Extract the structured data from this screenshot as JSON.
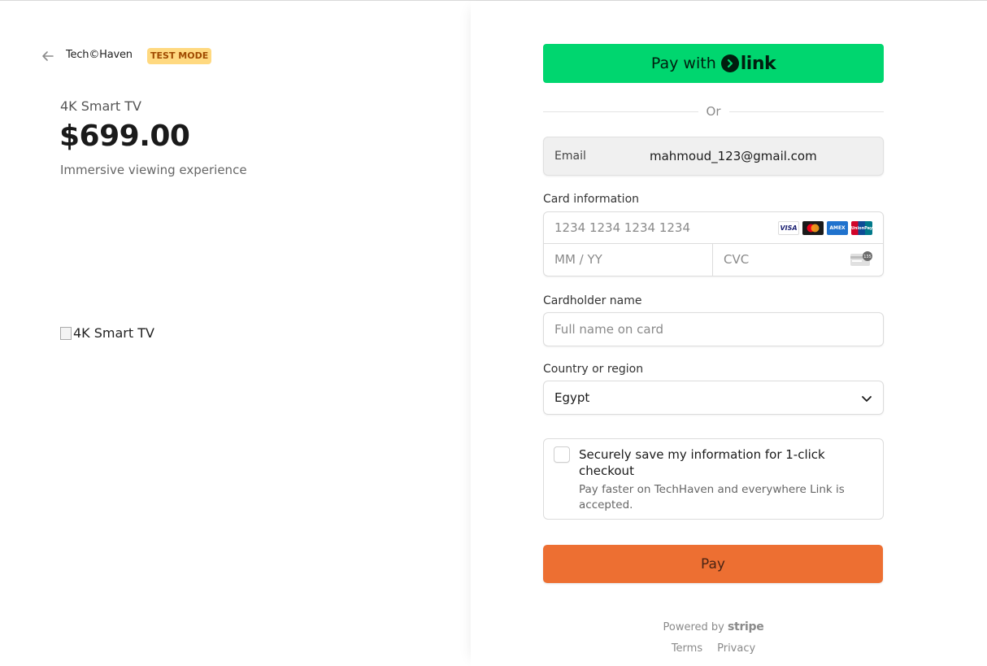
{
  "merchant": {
    "brand": "Tech©Haven",
    "test_badge": "TEST MODE"
  },
  "product": {
    "name": "4K Smart TV",
    "price": "$699.00",
    "description": "Immersive viewing experience",
    "image_alt": "4K Smart TV"
  },
  "link_button": {
    "prefix": "Pay with",
    "brand": "link"
  },
  "divider_text": "Or",
  "email": {
    "label": "Email",
    "value": "mahmoud_123@gmail.com"
  },
  "card": {
    "label": "Card information",
    "number_placeholder": "1234 1234 1234 1234",
    "expiry_placeholder": "MM / YY",
    "cvc_placeholder": "CVC",
    "brand_icons": [
      "visa-icon",
      "mastercard-icon",
      "amex-icon",
      "unionpay-icon"
    ],
    "visa_text": "VISA",
    "amex_text": "AMEX",
    "unionpay_text": "UnionPay",
    "cvc_icon_text": "135"
  },
  "cardholder": {
    "label": "Cardholder name",
    "placeholder": "Full name on card"
  },
  "country": {
    "label": "Country or region",
    "value": "Egypt"
  },
  "save_info": {
    "title": "Securely save my information for 1-click checkout",
    "subtitle": "Pay faster on TechHaven and everywhere Link is accepted.",
    "checked": false
  },
  "pay_button": {
    "label": "Pay"
  },
  "footer": {
    "powered_by": "Powered by",
    "stripe": "stripe",
    "terms": "Terms",
    "privacy": "Privacy"
  },
  "colors": {
    "link_green": "#00d66f",
    "pay_orange": "#ed6f32",
    "test_badge_bg": "#ffd980",
    "test_badge_text": "#a04a00"
  }
}
